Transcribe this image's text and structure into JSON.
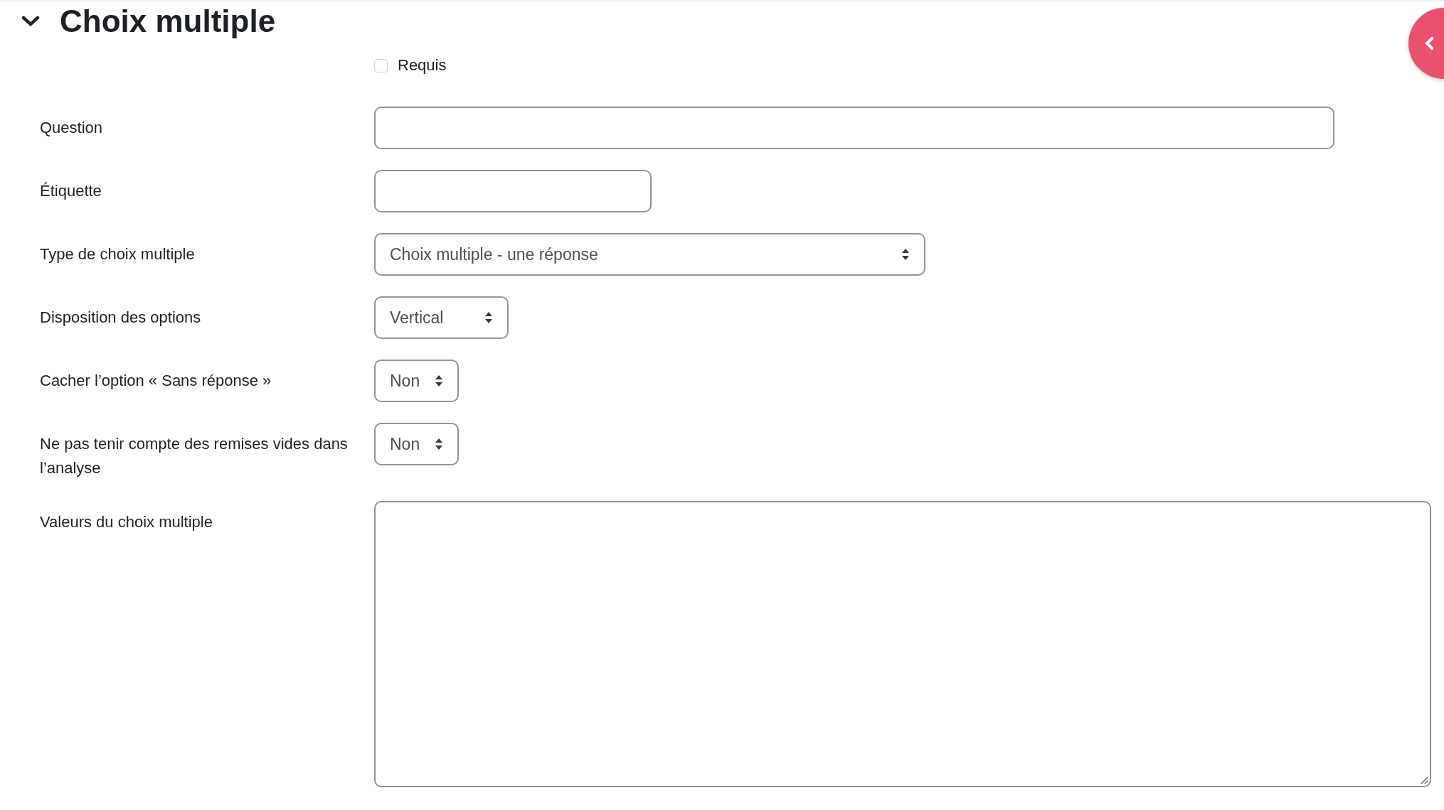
{
  "section": {
    "title": "Choix multiple",
    "expanded": true
  },
  "required": {
    "label": "Requis",
    "checked": false
  },
  "fields": [
    {
      "label": "Question",
      "kind": "text"
    },
    {
      "label": "Étiquette",
      "kind": "short"
    },
    {
      "label": "Type de choix multiple",
      "kind": "select",
      "value": "Choix multiple - une réponse"
    },
    {
      "label": "Disposition des options",
      "kind": "select",
      "value": "Vertical"
    },
    {
      "label": "Cacher l’option « Sans réponse »",
      "kind": "select",
      "value": "Non"
    },
    {
      "label": "Ne pas tenir compte des remises vides dans l’analyse",
      "kind": "select",
      "value": "Non"
    },
    {
      "label": "Valeurs du choix multiple",
      "kind": "textarea"
    }
  ]
}
